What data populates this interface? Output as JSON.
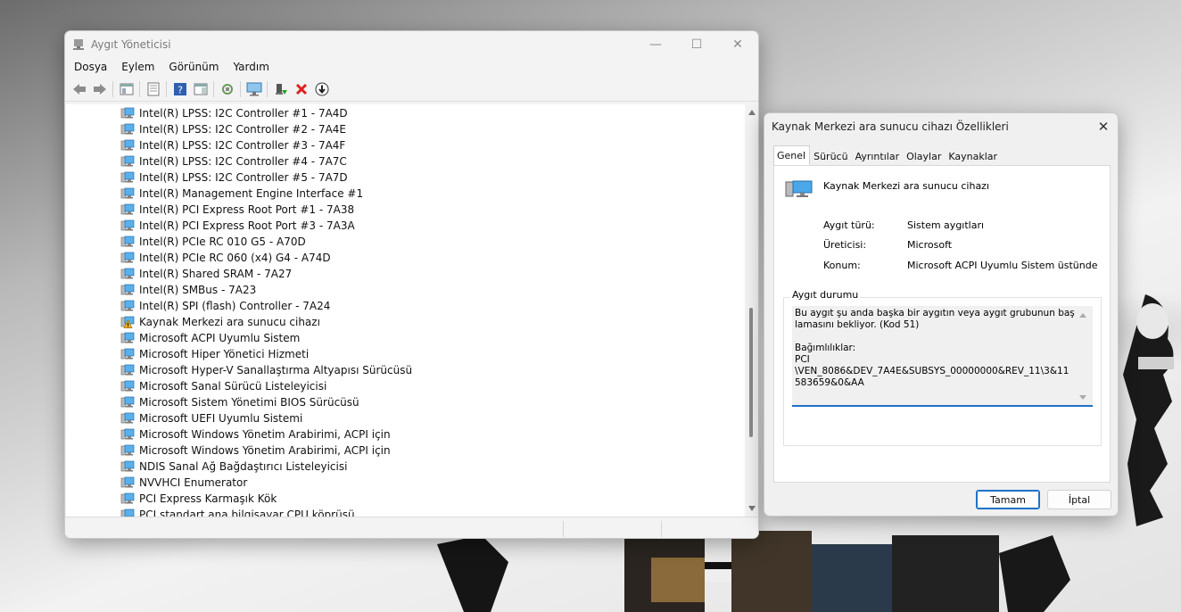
{
  "device_manager": {
    "title": "Aygıt Yöneticisi",
    "menu": [
      "Dosya",
      "Eylem",
      "Görünüm",
      "Yardım"
    ],
    "devices": [
      {
        "label": "Intel(R) LPSS: I2C Controller #1 - 7A4D",
        "icon": "system-device-icon"
      },
      {
        "label": "Intel(R) LPSS: I2C Controller #2 - 7A4E",
        "icon": "system-device-icon"
      },
      {
        "label": "Intel(R) LPSS: I2C Controller #3 - 7A4F",
        "icon": "system-device-icon"
      },
      {
        "label": "Intel(R) LPSS: I2C Controller #4 - 7A7C",
        "icon": "system-device-icon"
      },
      {
        "label": "Intel(R) LPSS: I2C Controller #5 - 7A7D",
        "icon": "system-device-icon"
      },
      {
        "label": "Intel(R) Management Engine Interface #1",
        "icon": "system-device-icon"
      },
      {
        "label": "Intel(R) PCI Express Root Port #1 - 7A38",
        "icon": "system-device-icon"
      },
      {
        "label": "Intel(R) PCI Express Root Port #3 - 7A3A",
        "icon": "system-device-icon"
      },
      {
        "label": "Intel(R) PCIe RC 010 G5 - A70D",
        "icon": "system-device-icon"
      },
      {
        "label": "Intel(R) PCIe RC 060 (x4) G4 - A74D",
        "icon": "system-device-icon"
      },
      {
        "label": "Intel(R) Shared SRAM - 7A27",
        "icon": "system-device-icon"
      },
      {
        "label": "Intel(R) SMBus - 7A23",
        "icon": "system-device-icon"
      },
      {
        "label": "Intel(R) SPI (flash) Controller - 7A24",
        "icon": "system-device-icon"
      },
      {
        "label": "Kaynak Merkezi ara sunucu cihazı",
        "icon": "warning-device-icon"
      },
      {
        "label": "Microsoft ACPI Uyumlu Sistem",
        "icon": "system-device-icon"
      },
      {
        "label": "Microsoft Hiper Yönetici Hizmeti",
        "icon": "system-device-icon"
      },
      {
        "label": "Microsoft Hyper-V Sanallaştırma Altyapısı Sürücüsü",
        "icon": "system-device-icon"
      },
      {
        "label": "Microsoft Sanal Sürücü Listeleyicisi",
        "icon": "system-device-icon"
      },
      {
        "label": "Microsoft Sistem Yönetimi BIOS Sürücüsü",
        "icon": "system-device-icon"
      },
      {
        "label": "Microsoft UEFI Uyumlu Sistemi",
        "icon": "system-device-icon"
      },
      {
        "label": "Microsoft Windows Yönetim Arabirimi, ACPI için",
        "icon": "system-device-icon"
      },
      {
        "label": "Microsoft Windows Yönetim Arabirimi, ACPI için",
        "icon": "system-device-icon"
      },
      {
        "label": "NDIS Sanal Ağ Bağdaştırıcı Listeleyicisi",
        "icon": "system-device-icon"
      },
      {
        "label": "NVVHCI Enumerator",
        "icon": "system-device-icon"
      },
      {
        "label": "PCI Express Karmaşık Kök",
        "icon": "system-device-icon"
      },
      {
        "label": "PCI standart ana bilgisayar CPU köprüsü",
        "icon": "system-device-icon"
      }
    ]
  },
  "properties": {
    "title": "Kaynak Merkezi ara sunucu cihazı Özellikleri",
    "tabs": [
      "Genel",
      "Sürücü",
      "Ayrıntılar",
      "Olaylar",
      "Kaynaklar"
    ],
    "device_name": "Kaynak Merkezi ara sunucu cihazı",
    "type_label": "Aygıt türü:",
    "type_value": "Sistem aygıtları",
    "manufacturer_label": "Üreticisi:",
    "manufacturer_value": "Microsoft",
    "location_label": "Konum:",
    "location_value": "Microsoft ACPI Uyumlu Sistem üstünde",
    "status_group_label": "Aygıt durumu",
    "status_text": "Bu aygıt şu anda başka bir aygıtın veya aygıt grubunun başlamasını bekliyor. (Kod 51)\n\nBağımlılıklar:\nPCI\n\\VEN_8086&DEV_7A4E&SUBSYS_00000000&REV_11\\3&11583659&0&AA",
    "ok_label": "Tamam",
    "cancel_label": "İptal"
  },
  "colors": {
    "accent": "#1e72c8",
    "warning": "#f2b01e",
    "error": "#e02020"
  }
}
